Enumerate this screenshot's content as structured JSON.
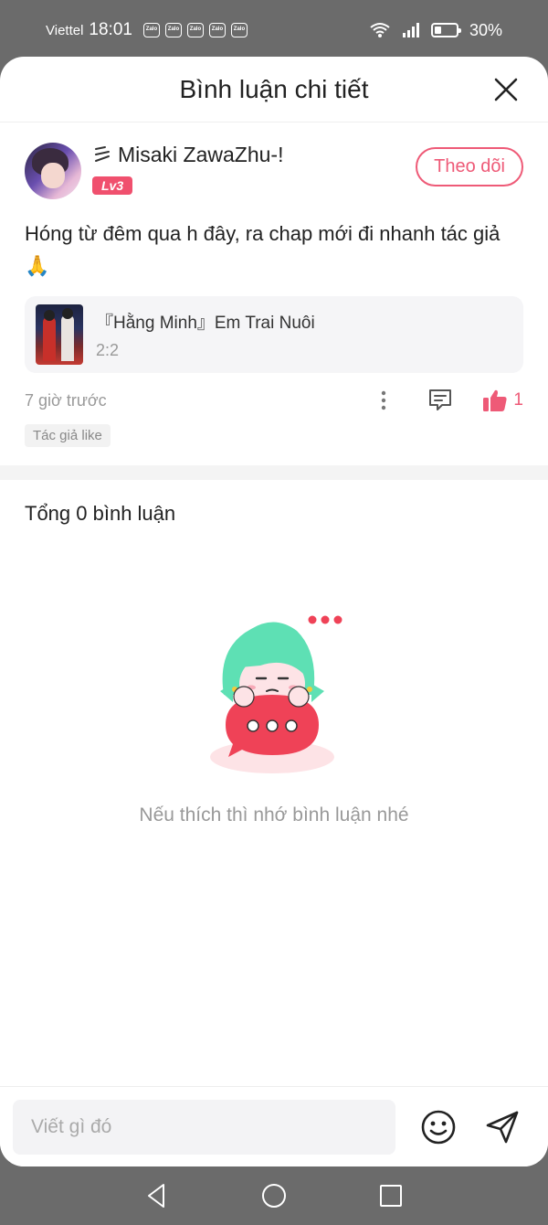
{
  "status_bar": {
    "carrier": "Viettel",
    "time": "18:01",
    "notification_icons": [
      "Zalo",
      "Zalo",
      "Zalo",
      "Zalo",
      "Zalo"
    ],
    "battery_percent": "30%",
    "battery_level": 0.3,
    "icons": [
      "wifi-icon",
      "signal-icon",
      "battery-icon"
    ]
  },
  "sheet": {
    "title": "Bình luận chi tiết",
    "close_icon": "close-icon"
  },
  "post": {
    "author": {
      "name": "Misaki ZawaZhu-!",
      "level": "Lv3",
      "follow_label": "Theo dõi"
    },
    "text": "Hóng từ đêm qua h đây, ra chap mới đi nhanh tác giả",
    "emoji": "🙏",
    "book": {
      "title": "『Hằng Minh』Em Trai Nuôi",
      "chapter": "2:2"
    },
    "time": "7 giờ trước",
    "like_count": "1",
    "author_liked_tag": "Tác giả like"
  },
  "comments": {
    "total_label": "Tổng 0 bình luận",
    "empty_message": "Nếu thích thì nhớ bình luận nhé"
  },
  "input": {
    "placeholder": "Viết gì đó"
  },
  "colors": {
    "accent": "#ee5a77",
    "level_badge": "#f0506e",
    "mascot_hair": "#5ee0b4",
    "bubble": "#ef4257"
  }
}
